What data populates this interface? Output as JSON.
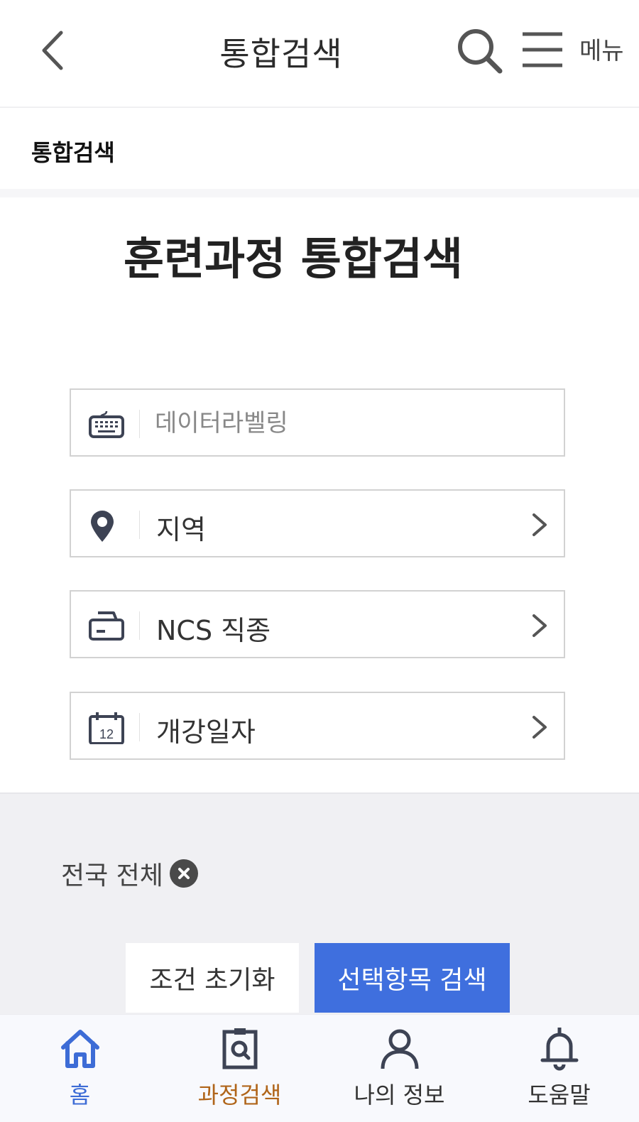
{
  "header": {
    "title": "통합검색",
    "menu_label": "메뉴"
  },
  "breadcrumb": {
    "label": "통합검색"
  },
  "main": {
    "title": "훈련과정 통합검색",
    "keyword_value": "",
    "keyword_placeholder": "데이터라벨링",
    "region_label": "지역",
    "ncs_label": "NCS 직종",
    "date_label": "개강일자",
    "calendar_day": "12"
  },
  "filters": {
    "chip_label": "전국 전체"
  },
  "actions": {
    "reset_label": "조건 초기화",
    "search_label": "선택항목 검색"
  },
  "bottom_nav": {
    "home": "홈",
    "course_search": "과정검색",
    "my_info": "나의 정보",
    "help": "도움말"
  },
  "colors": {
    "accent_blue": "#3f6fde",
    "nav_active_home": "#3d6cd6",
    "nav_active_course": "#b0651a",
    "icon_dark": "#3d4354"
  }
}
